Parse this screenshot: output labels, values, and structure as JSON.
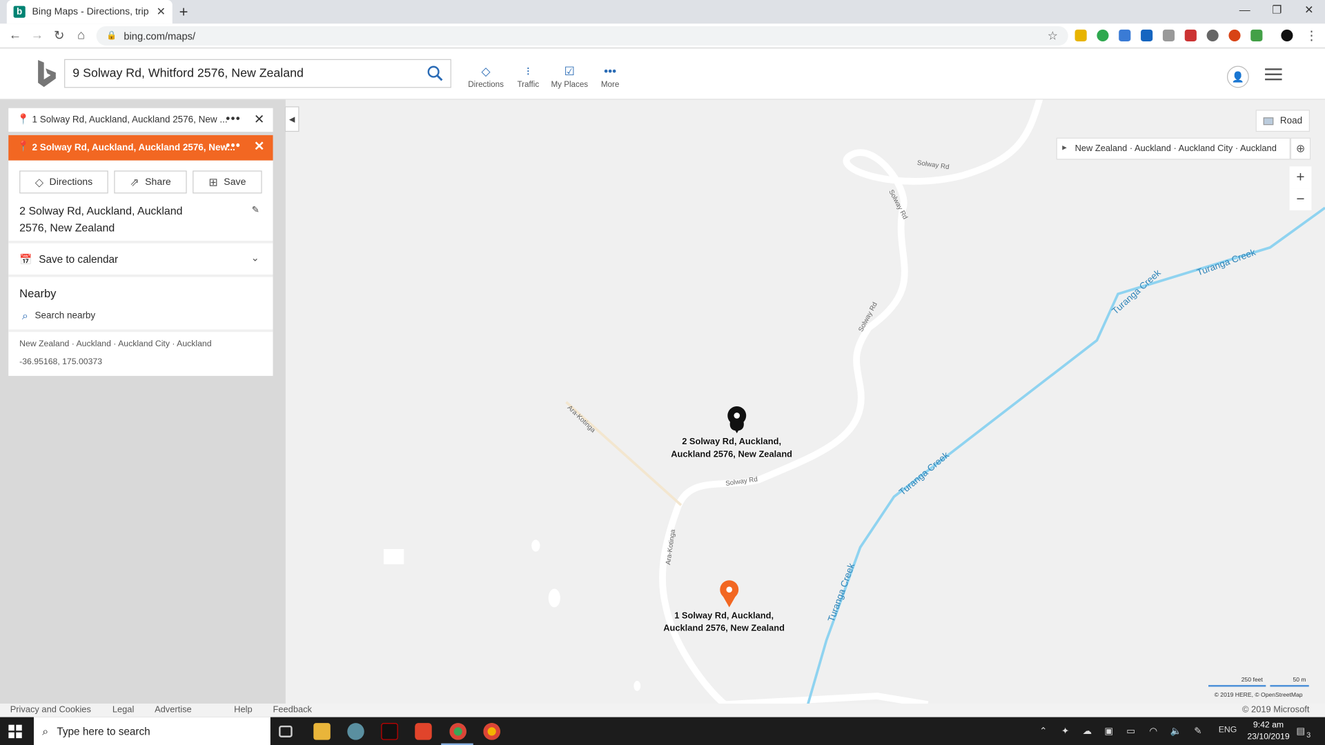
{
  "browser": {
    "tab_title": "Bing Maps - Directions, trip plann",
    "url": "bing.com/maps/"
  },
  "header": {
    "search_value": "9 Solway Rd, Whitford 2576, New Zealand",
    "nav": [
      {
        "label": "Directions",
        "icon": "directions-icon"
      },
      {
        "label": "Traffic",
        "icon": "traffic-icon"
      },
      {
        "label": "My Places",
        "icon": "my-places-icon"
      },
      {
        "label": "More",
        "icon": "more-icon"
      }
    ]
  },
  "panel": {
    "waypoint1": "1 Solway Rd, Auckland, Auckland 2576, New ...",
    "waypoint2": "2 Solway Rd, Auckland, Auckland 2576, New...",
    "actions": {
      "directions": "Directions",
      "share": "Share",
      "save": "Save"
    },
    "address_line1": "2 Solway Rd, Auckland, Auckland",
    "address_line2": "2576, New Zealand",
    "save_to_calendar": "Save to calendar",
    "nearby_title": "Nearby",
    "search_nearby": "Search nearby",
    "breadcrumb": "New Zealand · Auckland · Auckland City · Auckland",
    "coordinates": "-36.95168, 175.00373"
  },
  "map": {
    "style_button": "Road",
    "breadcrumb": "New Zealand · Auckland · Auckland City · Auckland",
    "road_labels": [
      "Solway Rd",
      "Solway Rd",
      "Solway Rd",
      "Solway Rd",
      "Ara-Kotinga",
      "Ara-Kotinga"
    ],
    "creek_labels": [
      "Turanga Creek",
      "Turanga Creek",
      "Turanga Creek",
      "Turanga Creek",
      "Turanga Creek"
    ],
    "pin_black_line1": "2 Solway Rd, Auckland,",
    "pin_black_line2": "Auckland 2576, New Zealand",
    "pin_orange_line1": "1 Solway Rd, Auckland,",
    "pin_orange_line2": "Auckland 2576, New Zealand",
    "scale_feet": "250 feet",
    "scale_m": "50 m",
    "attribution": "© 2019 HERE, © OpenStreetMap",
    "colors": {
      "road": "#ffffff",
      "creek": "#8fd3f0",
      "pin_orange": "#f26722",
      "pin_black": "#111111"
    }
  },
  "footer": {
    "links": [
      "Privacy and Cookies",
      "Legal",
      "Advertise",
      "Help",
      "Feedback"
    ],
    "copyright": "© 2019 Microsoft"
  },
  "taskbar": {
    "search_placeholder": "Type here to search",
    "language": "ENG",
    "time": "9:42 am",
    "date": "23/10/2019",
    "notifications": "3"
  }
}
